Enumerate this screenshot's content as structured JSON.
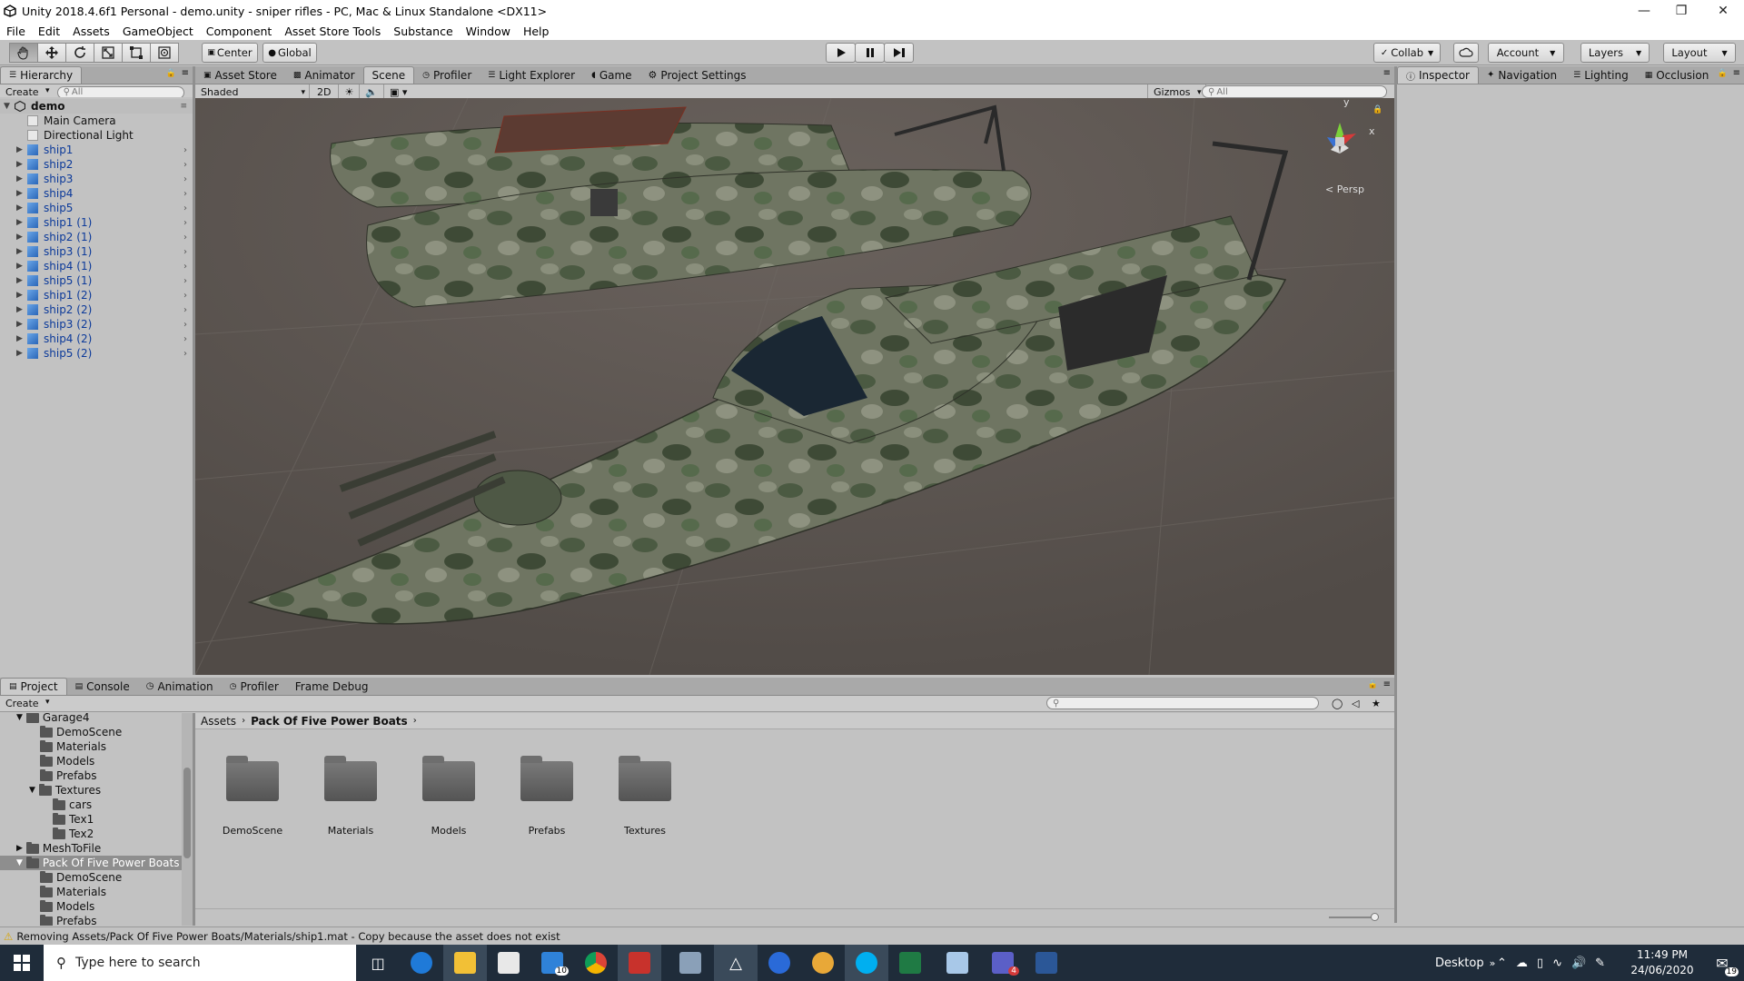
{
  "title": {
    "text": "Unity 2018.4.6f1 Personal - demo.unity - sniper rifles - PC, Mac & Linux Standalone <DX11>"
  },
  "menu": [
    "File",
    "Edit",
    "Assets",
    "GameObject",
    "Component",
    "Asset Store Tools",
    "Substance",
    "Window",
    "Help"
  ],
  "toolbar": {
    "pivot_label": "Center",
    "space_label": "Global",
    "collab_label": "Collab",
    "account_label": "Account",
    "layers_label": "Layers",
    "layout_label": "Layout"
  },
  "hierarchy": {
    "tab_label": "Hierarchy",
    "create_label": "Create",
    "search_placeholder": "All",
    "scene_name": "demo",
    "items": [
      {
        "label": "Main Camera"
      },
      {
        "label": "Directional Light"
      },
      {
        "label": "ship1"
      },
      {
        "label": "ship2"
      },
      {
        "label": "ship3"
      },
      {
        "label": "ship4"
      },
      {
        "label": "ship5"
      },
      {
        "label": "ship1 (1)"
      },
      {
        "label": "ship2 (1)"
      },
      {
        "label": "ship3 (1)"
      },
      {
        "label": "ship4 (1)"
      },
      {
        "label": "ship5 (1)"
      },
      {
        "label": "ship1 (2)"
      },
      {
        "label": "ship2 (2)"
      },
      {
        "label": "ship3 (2)"
      },
      {
        "label": "ship4 (2)"
      },
      {
        "label": "ship5 (2)"
      }
    ]
  },
  "center_tabs": [
    "Asset Store",
    "Animator",
    "Scene",
    "Profiler",
    "Light Explorer",
    "Game",
    "Project Settings"
  ],
  "scene_bar": {
    "shading": "Shaded",
    "mode_2d": "2D",
    "gizmos": "Gizmos",
    "search_placeholder": "All",
    "persp_label": "< Persp",
    "axis_y": "y",
    "axis_x": "x"
  },
  "right_tabs": [
    "Inspector",
    "Navigation",
    "Lighting",
    "Occlusion"
  ],
  "bottom_tabs": [
    "Project",
    "Console",
    "Animation",
    "Profiler",
    "Frame Debug"
  ],
  "project": {
    "create_label": "Create",
    "tree": [
      {
        "label": "Garage4"
      },
      {
        "label": "DemoScene"
      },
      {
        "label": "Materials"
      },
      {
        "label": "Models"
      },
      {
        "label": "Prefabs"
      },
      {
        "label": "Textures"
      },
      {
        "label": "cars"
      },
      {
        "label": "Tex1"
      },
      {
        "label": "Tex2"
      },
      {
        "label": "MeshToFile"
      },
      {
        "label": "Pack Of Five Power Boats"
      },
      {
        "label": "DemoScene"
      },
      {
        "label": "Materials"
      },
      {
        "label": "Models"
      },
      {
        "label": "Prefabs"
      }
    ],
    "breadcrumb": [
      "Assets",
      "Pack Of Five Power Boats"
    ],
    "folders": [
      "DemoScene",
      "Materials",
      "Models",
      "Prefabs",
      "Textures"
    ]
  },
  "status": {
    "text": "Removing Assets/Pack Of Five Power Boats/Materials/ship1.mat - Copy because the asset does not exist"
  },
  "taskbar": {
    "search_placeholder": "Type here to search",
    "desktop_label": "Desktop",
    "time": "11:49 PM",
    "date": "24/06/2020",
    "mail_badge": "10",
    "teams_badge": "4",
    "notif_badge": "19"
  }
}
